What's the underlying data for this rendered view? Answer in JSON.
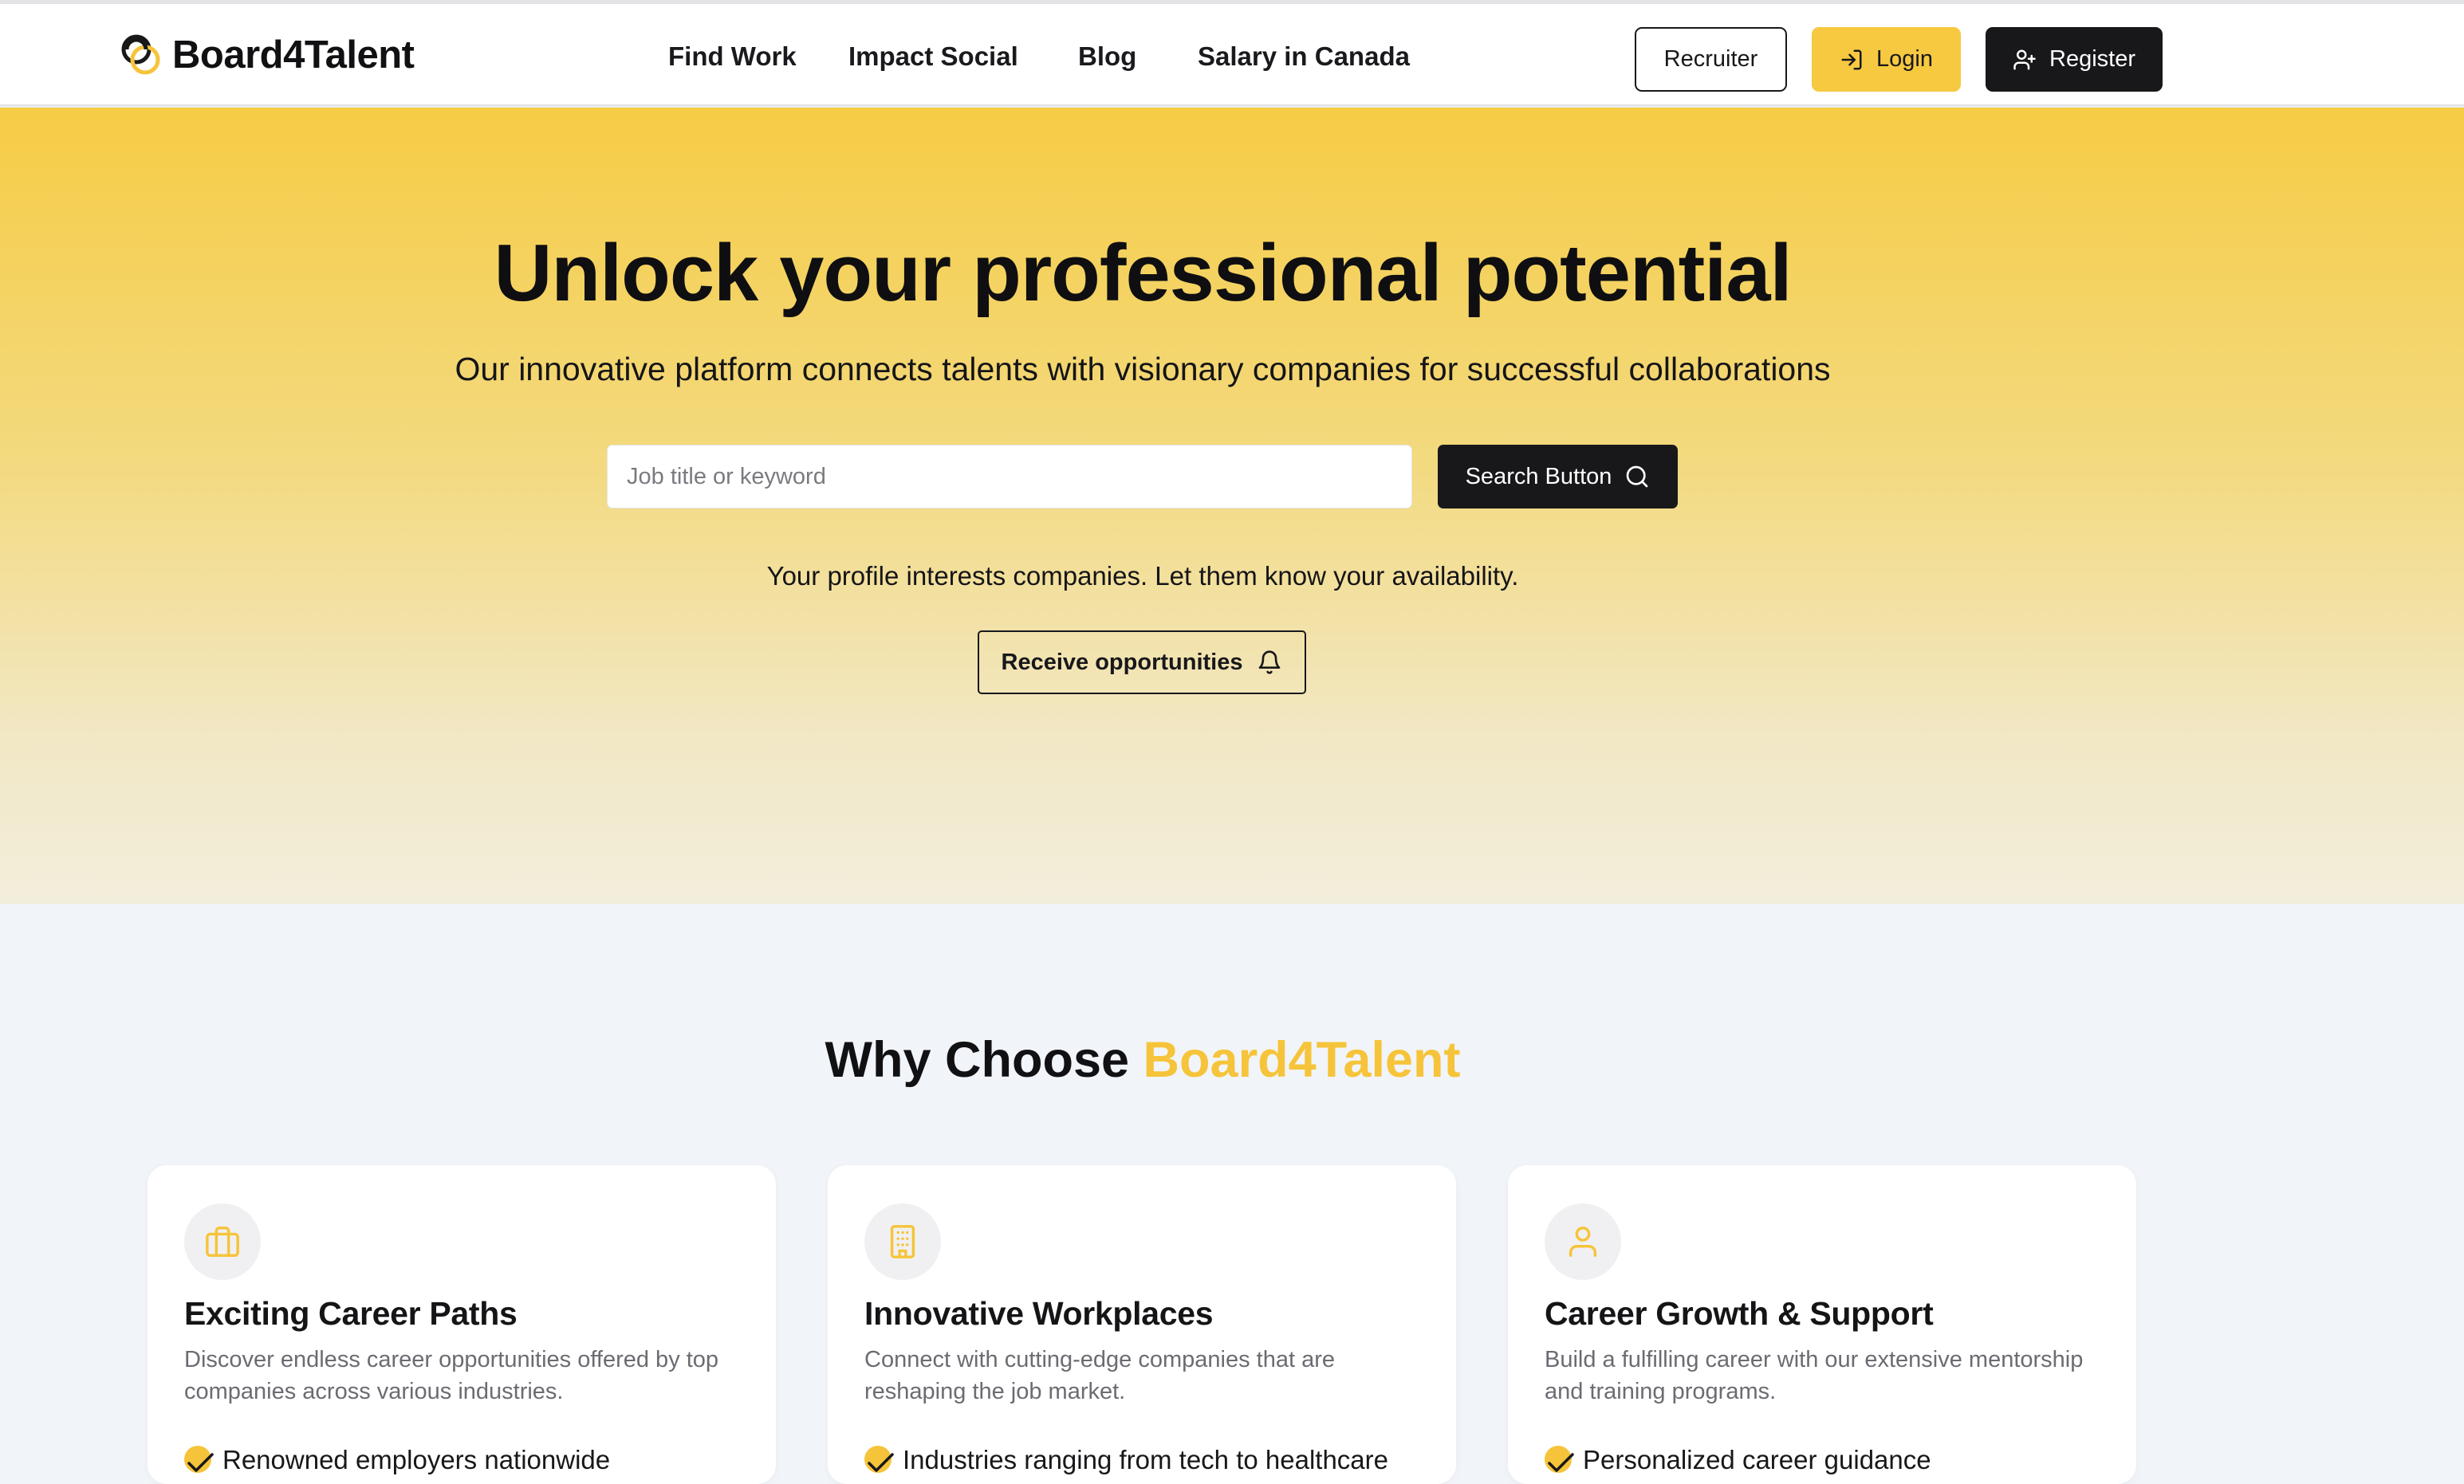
{
  "brand": {
    "name": "Board4Talent",
    "accent_color": "#f6c43a",
    "dark_color": "#18181b"
  },
  "nav": {
    "links": [
      {
        "label": "Find Work"
      },
      {
        "label": "Impact Social"
      },
      {
        "label": "Blog"
      },
      {
        "label": "Salary in Canada"
      }
    ],
    "recruiter_label": "Recruiter",
    "login_label": "Login",
    "register_label": "Register"
  },
  "hero": {
    "title": "Unlock your professional potential",
    "subtitle": "Our innovative platform connects talents with visionary companies for successful collaborations",
    "search": {
      "placeholder": "Job title or keyword",
      "value": "",
      "button_label": "Search Button"
    },
    "note": "Your profile interests companies. Let them know your availability.",
    "receive_label": "Receive opportunities"
  },
  "why": {
    "title_prefix": "Why Choose ",
    "title_accent": "Board4Talent",
    "cards": [
      {
        "icon": "briefcase-icon",
        "title": "Exciting Career Paths",
        "description": "Discover endless career opportunities offered by top companies across various industries.",
        "bullet": "Renowned employers nationwide"
      },
      {
        "icon": "building-icon",
        "title": "Innovative Workplaces",
        "description": "Connect with cutting-edge companies that are reshaping the job market.",
        "bullet": "Industries ranging from tech to healthcare"
      },
      {
        "icon": "user-icon",
        "title": "Career Growth & Support",
        "description": "Build a fulfilling career with our extensive mentorship and training programs.",
        "bullet": "Personalized career guidance"
      }
    ]
  }
}
